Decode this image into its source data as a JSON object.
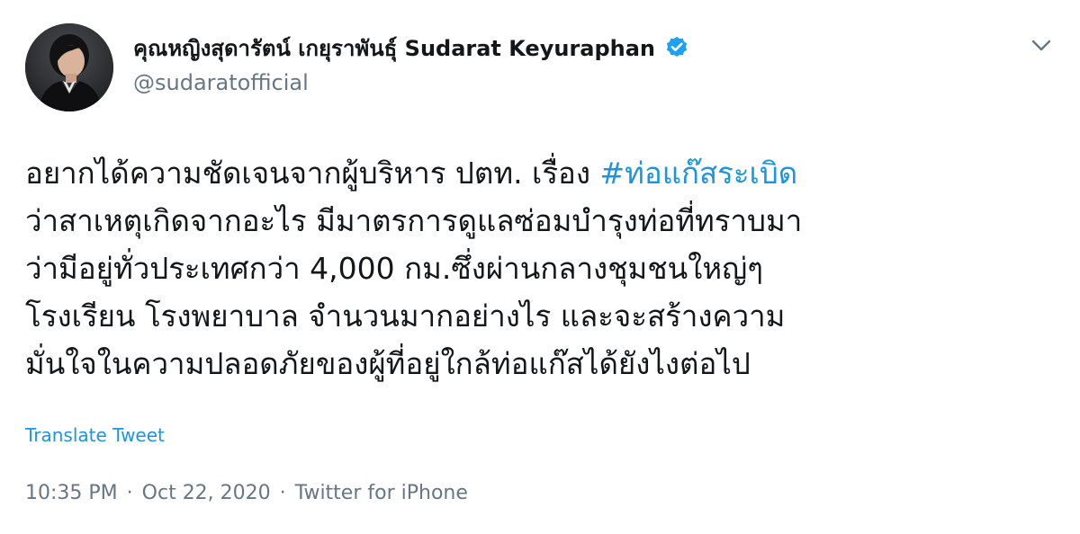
{
  "author": {
    "display_name": "คุณหญิงสุดารัตน์ เกยุราพันธุ์ Sudarat Keyuraphan",
    "handle": "@sudaratofficial",
    "verified": true,
    "avatar_icon": "profile-photo-avatar"
  },
  "menu": {
    "caret_icon": "chevron-down-icon"
  },
  "tweet": {
    "lines": [
      {
        "before": "อยากได้ความชัดเจนจากผู้บริหาร ปตท. เรื่อง ",
        "hashtag": "#ท่อแก๊สระเบิด"
      },
      {
        "text": "ว่าสาเหตุเกิดจากอะไร มีมาตรการดูแลซ่อมบำรุงท่อที่ทราบมา"
      },
      {
        "text": "ว่ามีอยู่ทั่วประเทศกว่า 4,000 กม.ซึ่งผ่านกลางชุมชนใหญ่ๆ"
      },
      {
        "text": "โรงเรียน โรงพยาบาล จำนวนมากอย่างไร และจะสร้างความ"
      },
      {
        "text": "มั่นใจในความปลอดภัยของผู้ที่อยู่ใกล้ท่อแก๊สได้ยังไงต่อไป"
      }
    ]
  },
  "translate_label": "Translate Tweet",
  "meta": {
    "time": "10:35 PM",
    "separator_1": "·",
    "date": "Oct 22, 2020",
    "separator_2": "·",
    "source": "Twitter for iPhone"
  },
  "colors": {
    "link": "#1b95e0",
    "muted": "#657786",
    "text": "#14171a",
    "verified_badge": "#1da1f2"
  }
}
